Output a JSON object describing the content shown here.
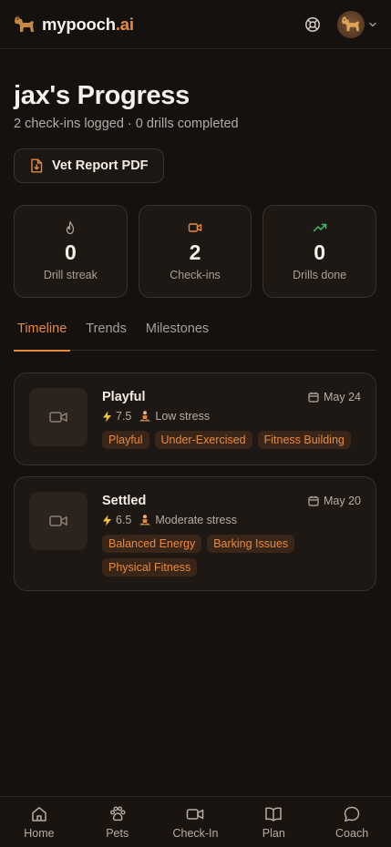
{
  "header": {
    "brand_name": "mypooch",
    "brand_suffix": ".ai",
    "icons": {
      "logo": "dog-icon",
      "help": "lifebuoy-icon",
      "avatar": "dog-avatar",
      "menu": "chevron-down-icon"
    }
  },
  "progress": {
    "title": "jax's Progress",
    "subtitle": "2 check-ins logged · 0 drills completed",
    "vet_report_label": "Vet Report PDF"
  },
  "stats": [
    {
      "icon": "flame-icon",
      "value": "0",
      "label": "Drill streak"
    },
    {
      "icon": "video-icon",
      "value": "2",
      "label": "Check-ins"
    },
    {
      "icon": "trending-up-icon",
      "value": "0",
      "label": "Drills done"
    }
  ],
  "tabs": [
    {
      "label": "Timeline",
      "active": true
    },
    {
      "label": "Trends",
      "active": false
    },
    {
      "label": "Milestones",
      "active": false
    }
  ],
  "checkins": [
    {
      "title": "Playful",
      "date": "May 24",
      "energy": "7.5",
      "stress": "Low stress",
      "tags": [
        "Playful",
        "Under-Exercised",
        "Fitness Building"
      ]
    },
    {
      "title": "Settled",
      "date": "May 20",
      "energy": "6.5",
      "stress": "Moderate stress",
      "tags": [
        "Balanced Energy",
        "Barking Issues",
        "Physical Fitness"
      ]
    }
  ],
  "nav": [
    {
      "label": "Home",
      "icon": "home-icon"
    },
    {
      "label": "Pets",
      "icon": "paw-icon"
    },
    {
      "label": "Check-In",
      "icon": "video-icon"
    },
    {
      "label": "Plan",
      "icon": "book-icon"
    },
    {
      "label": "Coach",
      "icon": "chat-icon"
    }
  ],
  "colors": {
    "background": "#15110e",
    "accent": "#e88a3c",
    "card": "#1d1814",
    "border": "#3a302a",
    "success": "#36c46a"
  }
}
